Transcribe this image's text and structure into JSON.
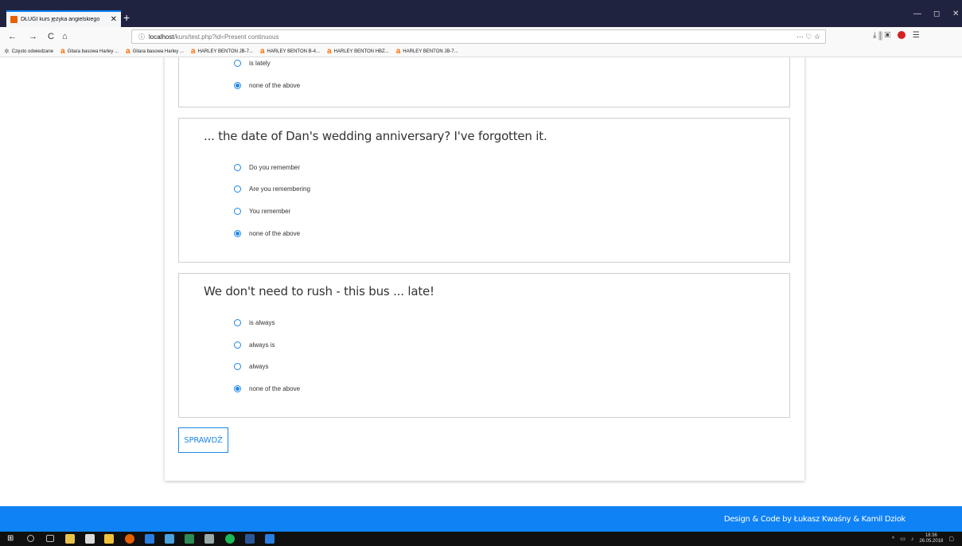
{
  "browser": {
    "tab_title": "DŁUGI kurs języka angielskiego",
    "tab_close": "✕",
    "new_tab": "+",
    "url_host": "localhost",
    "url_rest": "/kurs/test.php?id=Present continuous",
    "url_actions": "··· ♡ ☆",
    "toolbar_right": "⤓  ⫼  ▣",
    "back": "←",
    "forward": "→",
    "reload": "C",
    "home": "⌂",
    "minimize": "—",
    "maximize": "◻",
    "close": "✕"
  },
  "bookmarks": {
    "frequent": "Często odwiedzane",
    "items": [
      "Gitara basowa Harley ...",
      "Gitara basowa Harley ...",
      "HARLEY BENTON JB-7...",
      "HARLEY BENTON B-4...",
      "HARLEY BENTON HBZ...",
      "HARLEY BENTON JB-7..."
    ]
  },
  "quiz": {
    "q0": {
      "options": [
        "is lately",
        "none of the above"
      ]
    },
    "q1": {
      "text": "... the date of Dan's wedding anniversary? I've forgotten it.",
      "options": [
        "Do you remember",
        "Are you remembering",
        "You remember",
        "none of the above"
      ]
    },
    "q2": {
      "text": "We don't need to rush - this bus ... late!",
      "options": [
        "is always",
        "always is",
        "always",
        "none of the above"
      ]
    },
    "submit_label": "SPRAWDŹ"
  },
  "footer": {
    "credit": "Design & Code by Łukasz Kwaśny & Kamil Dziok"
  },
  "taskbar": {
    "time": "18:36",
    "date": "26.05.2018"
  },
  "colors": {
    "accent": "#1e88e5",
    "footer_bg": "#0f82f6",
    "tabbar_bg": "#202340"
  }
}
